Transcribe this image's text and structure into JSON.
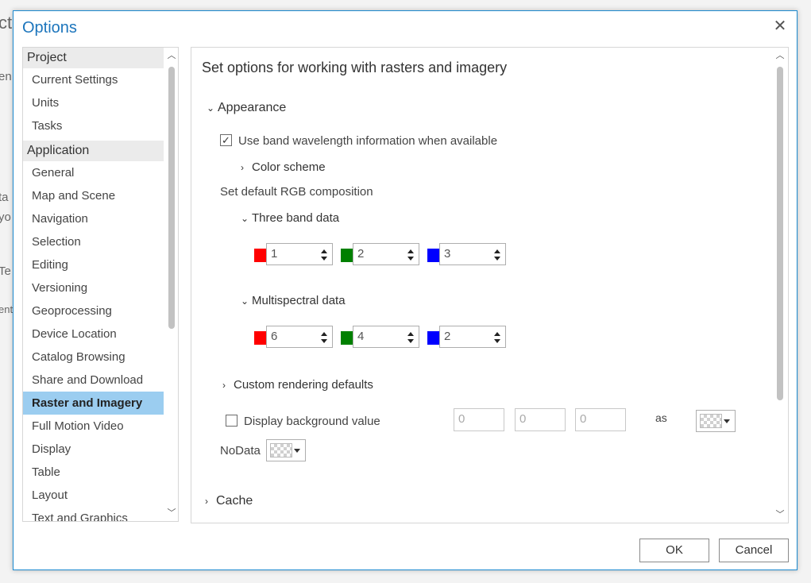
{
  "background": {
    "fragments": [
      "ct",
      "en",
      "ta",
      "yo",
      "Te",
      "ent"
    ]
  },
  "dialog": {
    "title": "Options",
    "close_glyph": "✕",
    "ok_label": "OK",
    "cancel_label": "Cancel"
  },
  "sidebar": {
    "groups": [
      {
        "header": "Project",
        "items": [
          "Current Settings",
          "Units",
          "Tasks"
        ]
      },
      {
        "header": "Application",
        "items": [
          "General",
          "Map and Scene",
          "Navigation",
          "Selection",
          "Editing",
          "Versioning",
          "Geoprocessing",
          "Device Location",
          "Catalog Browsing",
          "Share and Download",
          "Raster and Imagery",
          "Full Motion Video",
          "Display",
          "Table",
          "Layout",
          "Text and Graphics"
        ]
      }
    ],
    "selected": "Raster and Imagery"
  },
  "panel": {
    "title": "Set options for working with rasters and imagery",
    "appearance": {
      "label": "Appearance",
      "use_band_wavelength_label": "Use band wavelength information when available",
      "use_band_wavelength_checked": true,
      "color_scheme_label": "Color scheme",
      "rgb_composition_label": "Set default RGB composition",
      "three_band": {
        "label": "Three band data",
        "red": "1",
        "green": "2",
        "blue": "3"
      },
      "multispectral": {
        "label": "Multispectral data",
        "red": "6",
        "green": "4",
        "blue": "2"
      }
    },
    "custom_rendering_label": "Custom rendering defaults",
    "display_background": {
      "label": "Display background value",
      "checked": false,
      "values": [
        "0",
        "0",
        "0"
      ],
      "as_label": "as"
    },
    "nodata_label": "NoData",
    "cache_label": "Cache"
  },
  "colors": {
    "accent": "#1c75bc",
    "selected_item": "#9bcdf0",
    "red_swatch": "#ff0000",
    "green_swatch": "#008000",
    "blue_swatch": "#0000ff"
  },
  "icons": {
    "expanded": "chevron-down-icon",
    "collapsed": "chevron-right-icon",
    "checked": "checkmark-icon",
    "transparency": "checkerboard-icon"
  }
}
